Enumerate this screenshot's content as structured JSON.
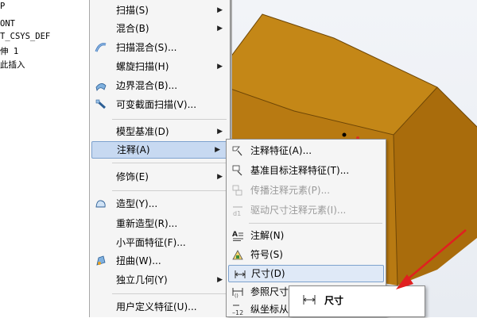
{
  "model_tree": {
    "items": [
      "P",
      "ONT",
      "T_CSYS_DEF",
      "伸 1",
      "此插入"
    ]
  },
  "context_menu": {
    "items": [
      {
        "label": "扫描(S)",
        "submenu": true
      },
      {
        "label": "混合(B)",
        "submenu": true
      },
      {
        "label": "扫描混合(S)...",
        "submenu": false
      },
      {
        "label": "螺旋扫描(H)",
        "submenu": true
      },
      {
        "label": "边界混合(B)...",
        "submenu": false
      },
      {
        "label": "可变截面扫描(V)...",
        "submenu": false
      },
      {
        "label": "模型基准(D)",
        "submenu": true
      },
      {
        "label": "注释(A)",
        "submenu": true
      },
      {
        "label": "修饰(E)",
        "submenu": true
      },
      {
        "label": "造型(Y)...",
        "submenu": false
      },
      {
        "label": "重新造型(R)...",
        "submenu": false
      },
      {
        "label": "小平面特征(F)...",
        "submenu": false
      },
      {
        "label": "扭曲(W)...",
        "submenu": false
      },
      {
        "label": "独立几何(Y)",
        "submenu": true
      },
      {
        "label": "用户定义特征(U)...",
        "submenu": false
      }
    ]
  },
  "annotation_submenu": {
    "items": [
      {
        "label": "注释特征(A)...",
        "disabled": false
      },
      {
        "label": "基准目标注释特征(T)...",
        "disabled": false
      },
      {
        "label": "传播注释元素(P)...",
        "disabled": true
      },
      {
        "label": "驱动尺寸注释元素(I)...",
        "disabled": true
      },
      {
        "label": "注解(N)",
        "disabled": false
      },
      {
        "label": "符号(S)",
        "disabled": false
      },
      {
        "label": "尺寸(D)",
        "disabled": false
      },
      {
        "label": "参照尺寸",
        "disabled": false
      },
      {
        "label": "纵坐标从",
        "disabled": false
      }
    ]
  },
  "tooltip": {
    "label": "尺寸"
  },
  "colors": {
    "model_front": "#b87a12",
    "model_side": "#a96c0c",
    "model_top": "#c48717",
    "highlight": "#c7d9f1",
    "arrow": "#e02020"
  },
  "icons": {
    "sweep_blend": "sweep-blend-icon",
    "boundary_blend": "boundary-blend-icon",
    "var_section_sweep": "variable-section-sweep-icon",
    "style": "style-icon",
    "warp": "warp-icon",
    "annotation_feature": "annotation-feature-icon",
    "datum_target": "datum-target-icon",
    "propagate": "propagate-icon",
    "driving_dim": "driving-dimension-icon",
    "note": "note-icon",
    "symbol": "symbol-icon",
    "dimension": "dimension-icon",
    "ref_dimension": "reference-dimension-icon",
    "ordinate": "ordinate-icon"
  }
}
